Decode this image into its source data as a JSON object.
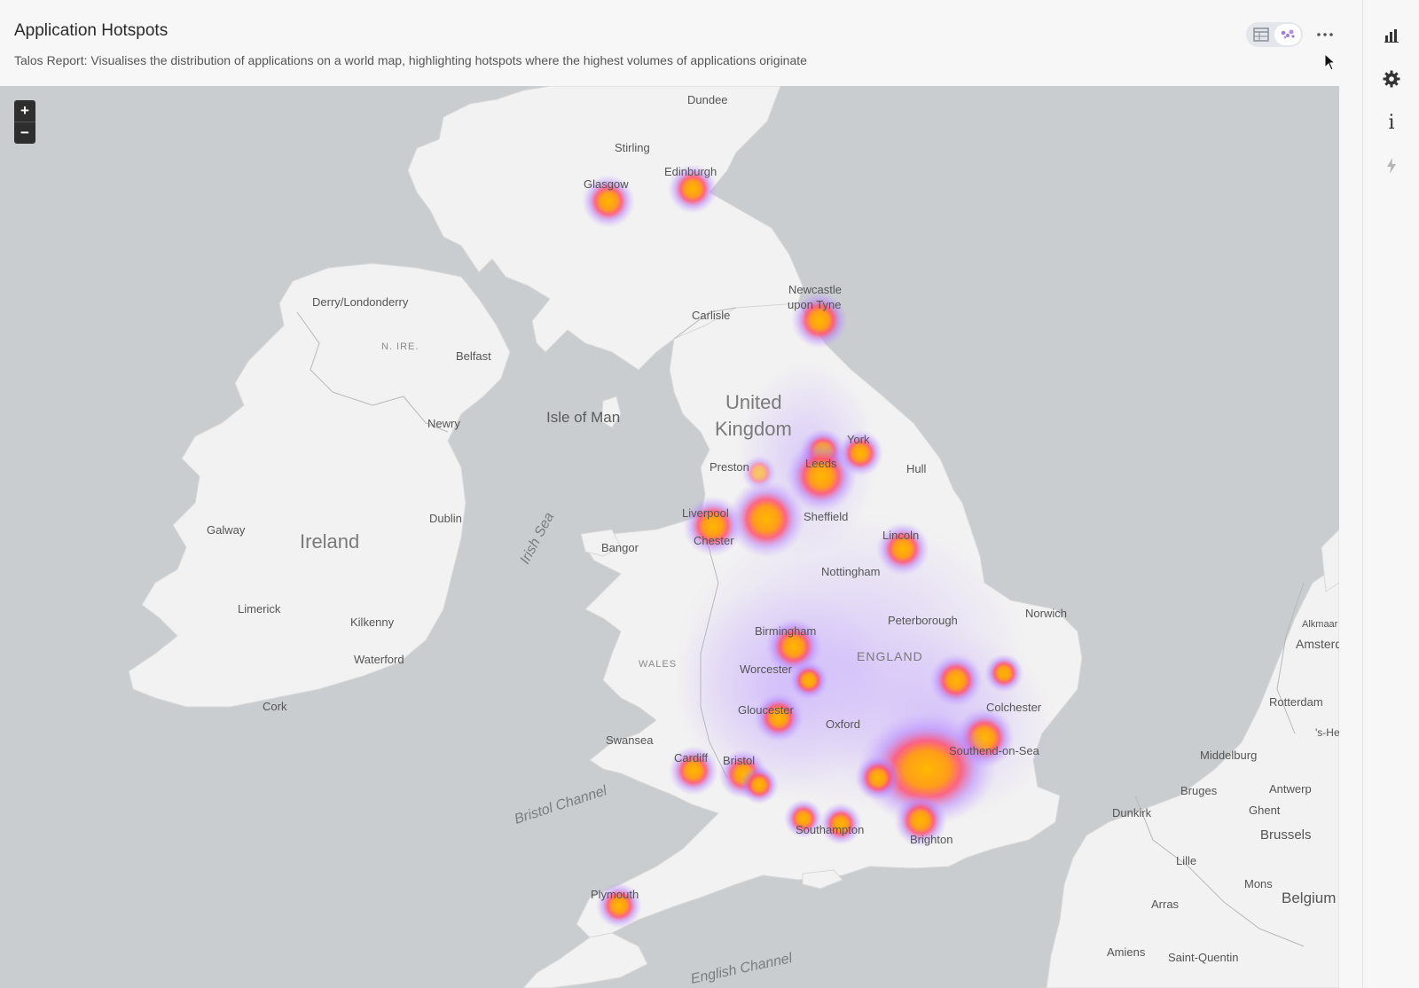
{
  "header": {
    "title": "Application Hotspots",
    "subtitle": "Talos Report: Visualises the distribution of applications on a world map, highlighting hotspots where the highest volumes of applications originate"
  },
  "toolbar": {
    "table_icon": "table-icon",
    "map_icon": "world-map-icon",
    "more_icon": "more-horizontal-icon"
  },
  "map": {
    "zoom_in": "+",
    "zoom_out": "−",
    "colors": {
      "sea": "#c9cdd0",
      "land": "#f2f2f2",
      "heat_core": "#ffb000",
      "heat_mid": "#ff4e6a",
      "heat_outer": "#b07cff"
    },
    "labels": {
      "dundee": "Dundee",
      "stirling": "Stirling",
      "glasgow": "Glasgow",
      "edinburgh": "Edinburgh",
      "derry": "Derry/Londonderry",
      "n_ire": "N. IRE.",
      "belfast": "Belfast",
      "newry": "Newry",
      "isle_of_man": "Isle of Man",
      "newcastle_1": "Newcastle",
      "newcastle_2": "upon Tyne",
      "carlisle": "Carlisle",
      "uk_1": "United",
      "uk_2": "Kingdom",
      "york": "York",
      "leeds": "Leeds",
      "preston": "Preston",
      "hull": "Hull",
      "galway": "Galway",
      "ireland": "Ireland",
      "dublin": "Dublin",
      "irish_sea": "Irish Sea",
      "liverpool": "Liverpool",
      "sheffield": "Sheffield",
      "chester": "Chester",
      "bangor": "Bangor",
      "lincoln": "Lincoln",
      "nottingham": "Nottingham",
      "limerick": "Limerick",
      "kilkenny": "Kilkenny",
      "waterford": "Waterford",
      "peterborough": "Peterborough",
      "norwich": "Norwich",
      "birmingham": "Birmingham",
      "england": "ENGLAND",
      "wales": "WALES",
      "worcester": "Worcester",
      "cork": "Cork",
      "colchester": "Colchester",
      "gloucester": "Gloucester",
      "oxford": "Oxford",
      "swansea": "Swansea",
      "southend": "Southend-on-Sea",
      "cardiff": "Cardiff",
      "bristol": "Bristol",
      "bristol_channel": "Bristol Channel",
      "southampton": "Southampton",
      "brighton": "Brighton",
      "plymouth": "Plymouth",
      "english_channel": "English Channel",
      "alkmaar": "Alkmaar",
      "amsterdam": "Amsterdam",
      "rotterdam": "Rotterdam",
      "s_hert": "'s-Hertogenbosch",
      "middelburg": "Middelburg",
      "bruges": "Bruges",
      "antwerp": "Antwerp",
      "ghent": "Ghent",
      "dunkirk": "Dunkirk",
      "brussels": "Brussels",
      "lille": "Lille",
      "mons": "Mons",
      "belgium": "Belgium",
      "arras": "Arras",
      "amiens": "Amiens",
      "saint_quentin": "Saint-Quentin"
    },
    "hotspots": [
      {
        "name": "Glasgow",
        "intensity": 0.7
      },
      {
        "name": "Edinburgh",
        "intensity": 0.65
      },
      {
        "name": "Newcastle upon Tyne",
        "intensity": 0.7
      },
      {
        "name": "Leeds",
        "intensity": 0.85
      },
      {
        "name": "York",
        "intensity": 0.55
      },
      {
        "name": "Manchester",
        "intensity": 0.95
      },
      {
        "name": "Liverpool",
        "intensity": 0.75
      },
      {
        "name": "Lincoln",
        "intensity": 0.6
      },
      {
        "name": "Birmingham",
        "intensity": 0.7
      },
      {
        "name": "Worcester",
        "intensity": 0.45
      },
      {
        "name": "Gloucester",
        "intensity": 0.55
      },
      {
        "name": "Cambridge",
        "intensity": 0.6
      },
      {
        "name": "Norwich",
        "intensity": 0.45
      },
      {
        "name": "Colchester",
        "intensity": 0.7
      },
      {
        "name": "London",
        "intensity": 1.0
      },
      {
        "name": "Brighton",
        "intensity": 0.6
      },
      {
        "name": "Cardiff",
        "intensity": 0.6
      },
      {
        "name": "Bristol",
        "intensity": 0.7
      },
      {
        "name": "Southampton",
        "intensity": 0.5
      },
      {
        "name": "Portsmouth",
        "intensity": 0.5
      },
      {
        "name": "Plymouth",
        "intensity": 0.55
      }
    ]
  },
  "rail": {
    "chart_icon": "bar-chart-icon",
    "settings_icon": "gear-icon",
    "info_icon": "info-icon",
    "bolt_icon": "lightning-icon",
    "info_glyph": "i"
  }
}
